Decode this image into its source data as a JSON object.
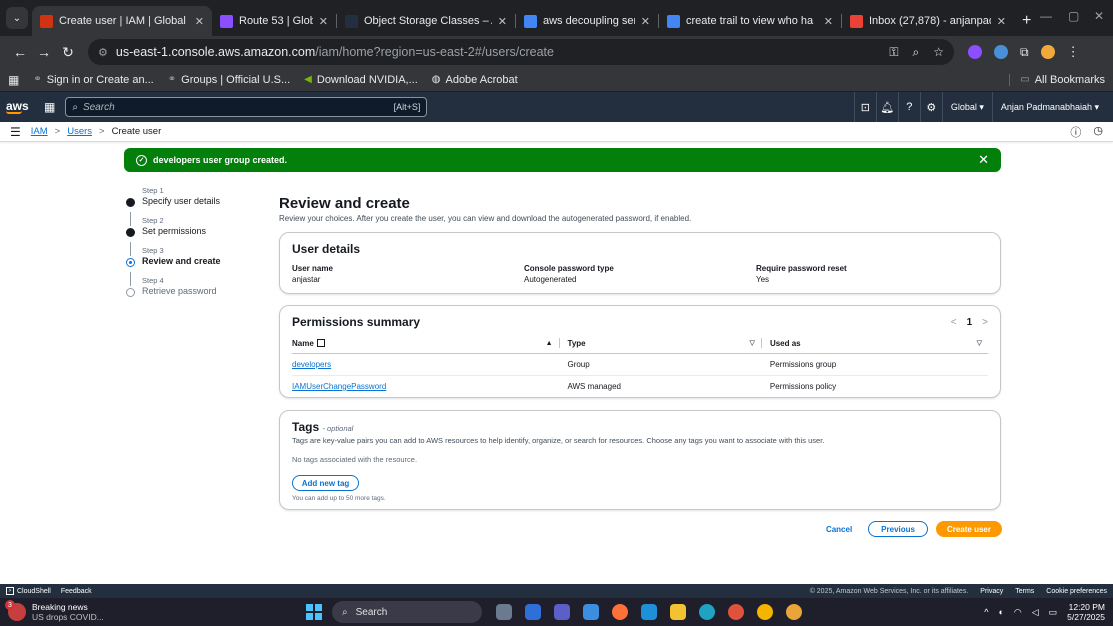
{
  "browser": {
    "tabs": [
      {
        "title": "Create user | IAM | Global",
        "active": true,
        "favicon_color": "#d13212"
      },
      {
        "title": "Route 53 | Global",
        "active": false,
        "favicon_color": "#8c4fff"
      },
      {
        "title": "Object Storage Classes – A",
        "active": false,
        "favicon_color": "#232f3e"
      },
      {
        "title": "aws decoupling services -",
        "active": false,
        "favicon_color": "#4285f4"
      },
      {
        "title": "create trail to view who ha",
        "active": false,
        "favicon_color": "#4285f4"
      },
      {
        "title": "Inbox (27,878) - anjanpad",
        "active": false,
        "favicon_color": "#ea4335"
      }
    ],
    "url_host": "us-east-1.console.aws.amazon.com",
    "url_path": "/iam/home?region=us-east-2#/users/create",
    "bookmarks": [
      {
        "label": "Sign in or Create an..."
      },
      {
        "label": "Groups | Official U.S..."
      },
      {
        "label": "Download NVIDIA,..."
      },
      {
        "label": "Adobe Acrobat"
      }
    ],
    "all_bookmarks": "All Bookmarks"
  },
  "aws_nav": {
    "logo": "aws",
    "search_placeholder": "Search",
    "search_shortcut": "[Alt+S]",
    "region": "Global ▾",
    "account": "Anjan Padmanabhaiah ▾"
  },
  "breadcrumb": {
    "items": [
      "IAM",
      "Users"
    ],
    "current": "Create user"
  },
  "flash": {
    "message": "developers user group created.",
    "color": "#037f0c"
  },
  "wizard": {
    "steps": [
      {
        "step": "Step 1",
        "name": "Specify user details",
        "state": "done"
      },
      {
        "step": "Step 2",
        "name": "Set permissions",
        "state": "done"
      },
      {
        "step": "Step 3",
        "name": "Review and create",
        "state": "current"
      },
      {
        "step": "Step 4",
        "name": "Retrieve password",
        "state": "todo"
      }
    ]
  },
  "main": {
    "title": "Review and create",
    "description": "Review your choices. After you create the user, you can view and download the autogenerated password, if enabled.",
    "user_details": {
      "title": "User details",
      "fields": [
        {
          "label": "User name",
          "value": "anjastar"
        },
        {
          "label": "Console password type",
          "value": "Autogenerated"
        },
        {
          "label": "Require password reset",
          "value": "Yes"
        }
      ]
    },
    "permissions": {
      "title": "Permissions summary",
      "page": "1",
      "columns": [
        "Name",
        "Type",
        "Used as"
      ],
      "rows": [
        {
          "name": "developers",
          "type": "Group",
          "used_as": "Permissions group"
        },
        {
          "name": "IAMUserChangePassword",
          "type": "AWS managed",
          "used_as": "Permissions policy"
        }
      ]
    },
    "tags": {
      "title": "Tags",
      "optional": "- optional",
      "description": "Tags are key-value pairs you can add to AWS resources to help identify, organize, or search for resources. Choose any tags you want to associate with this user.",
      "empty": "No tags associated with the resource.",
      "add_button": "Add new tag",
      "hint": "You can add up to 50 more tags."
    },
    "actions": {
      "cancel": "Cancel",
      "previous": "Previous",
      "create": "Create user"
    }
  },
  "footer": {
    "cloudshell": "CloudShell",
    "feedback": "Feedback",
    "copyright": "© 2025, Amazon Web Services, Inc. or its affiliates.",
    "privacy": "Privacy",
    "terms": "Terms",
    "cookies": "Cookie preferences"
  },
  "taskbar": {
    "news_badge": "3",
    "news_title": "Breaking news",
    "news_sub": "US drops COVID...",
    "search": "Search",
    "time": "12:20 PM",
    "date": "5/27/2025"
  }
}
